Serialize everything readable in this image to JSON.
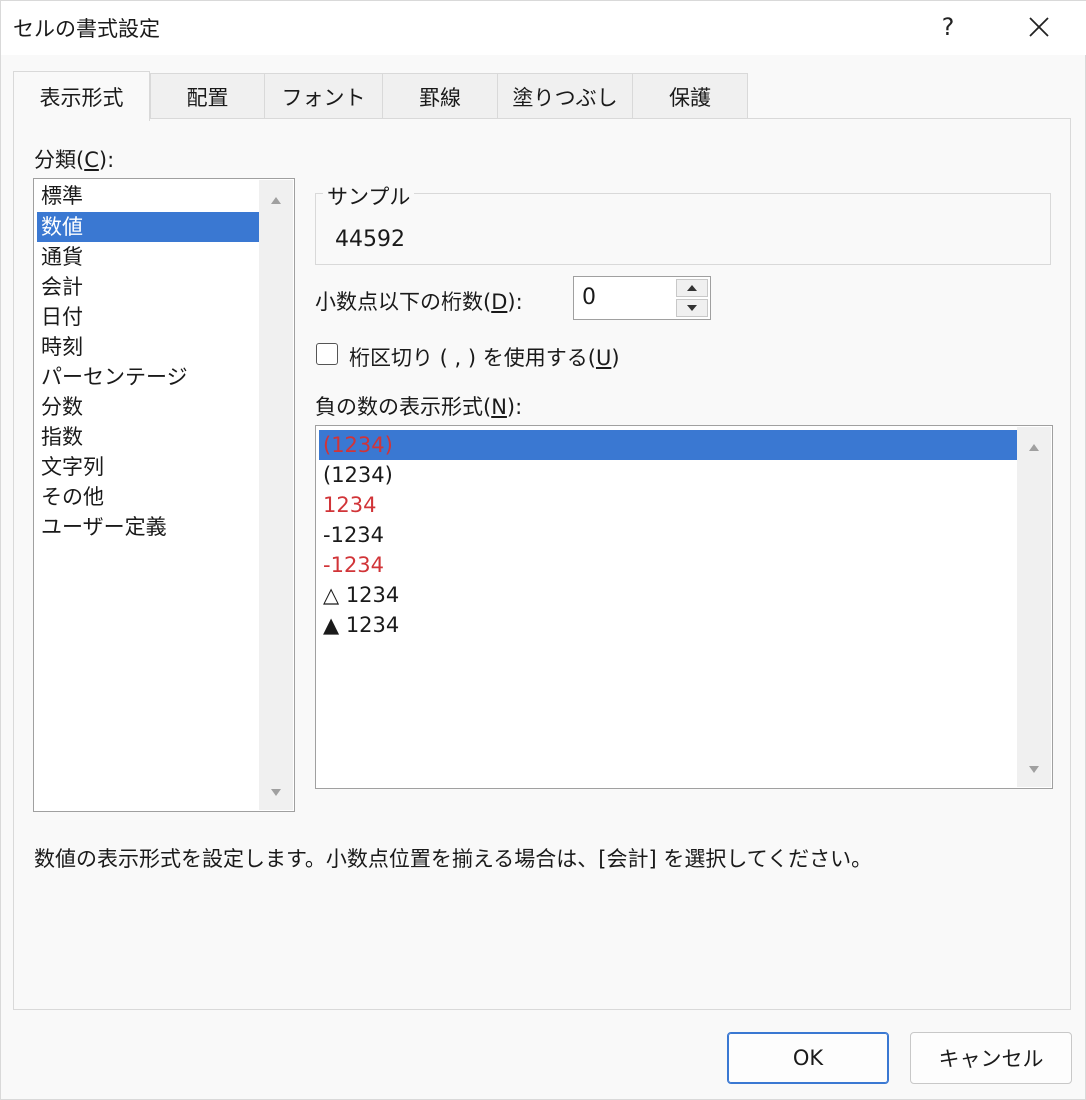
{
  "window": {
    "title": "セルの書式設定",
    "help_label": "?",
    "close_icon": "close-icon"
  },
  "tabs": [
    {
      "label": "表示形式",
      "active": true
    },
    {
      "label": "配置"
    },
    {
      "label": "フォント"
    },
    {
      "label": "罫線"
    },
    {
      "label": "塗りつぶし"
    },
    {
      "label": "保護"
    }
  ],
  "category": {
    "label_prefix": "分類(",
    "label_key": "C",
    "label_suffix": "):",
    "items": [
      "標準",
      "数値",
      "通貨",
      "会計",
      "日付",
      "時刻",
      "パーセンテージ",
      "分数",
      "指数",
      "文字列",
      "その他",
      "ユーザー定義"
    ],
    "selected": "数値"
  },
  "sample": {
    "label": "サンプル",
    "value": "44592"
  },
  "decimal_places": {
    "label_prefix": "小数点以下の桁数(",
    "label_key": "D",
    "label_suffix": "):",
    "value": "0"
  },
  "thousands_separator": {
    "label_prefix": "桁区切り ( , ) を使用する(",
    "label_key": "U",
    "label_suffix": ")",
    "checked": false
  },
  "negative_numbers": {
    "label_prefix": "負の数の表示形式(",
    "label_key": "N",
    "label_suffix": "):",
    "items": [
      {
        "text": "(1234)",
        "red": true,
        "selected": true
      },
      {
        "text": "(1234)",
        "red": false
      },
      {
        "text": "1234",
        "red": true
      },
      {
        "text": "-1234",
        "red": false
      },
      {
        "text": "-1234",
        "red": true
      },
      {
        "text": "△ 1234",
        "red": false
      },
      {
        "text": "▲ 1234",
        "red": false
      }
    ]
  },
  "description": "数値の表示形式を設定します。小数点位置を揃える場合は、[会計] を選択してください。",
  "buttons": {
    "ok": "OK",
    "cancel": "キャンセル"
  },
  "colors": {
    "selection": "#3a78d2",
    "negative_red": "#d13438"
  }
}
